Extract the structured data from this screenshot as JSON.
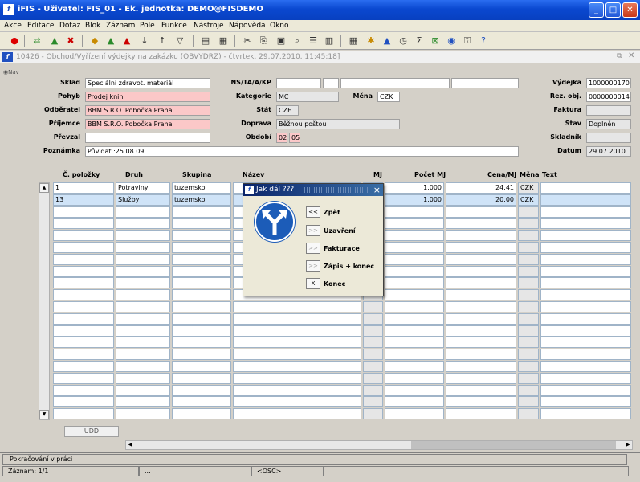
{
  "window": {
    "title": "iFIS - Uživatel: FIS_01 - Ek. jednotka: DEMO@FISDEMO"
  },
  "menu": [
    "Akce",
    "Editace",
    "Dotaz",
    "Blok",
    "Záznam",
    "Pole",
    "Funkce",
    "Nástroje",
    "Nápověda",
    "Okno"
  ],
  "document": {
    "title": "10426 - Obchod/Vyřízení výdejky na zakázku (OBVYDRZ) - čtvrtek, 29.07.2010, 11:45:18]"
  },
  "nav": {
    "label": "Nav"
  },
  "form": {
    "sklad": {
      "label": "Sklad",
      "value": "Speciální zdravot. materiál"
    },
    "pohyb": {
      "label": "Pohyb",
      "value": "Prodej knih"
    },
    "odberatel": {
      "label": "Odběratel",
      "value": "BBM S.R.O. Pobočka Praha"
    },
    "prijemce": {
      "label": "Příjemce",
      "value": "BBM S.R.O. Pobočka Praha"
    },
    "prevzal": {
      "label": "Převzal",
      "value": ""
    },
    "poznamka": {
      "label": "Poznámka",
      "value": "Pův.dat.:25.08.09"
    },
    "nstaakp": {
      "label": "NS/TA/A/KP"
    },
    "kategorie": {
      "label": "Kategorie",
      "value": "MC"
    },
    "mena": {
      "label": "Měna",
      "value": "CZK"
    },
    "stat": {
      "label": "Stát",
      "value": "CZE"
    },
    "doprava": {
      "label": "Doprava",
      "value": "Běžnou poštou"
    },
    "obdobi": {
      "label": "Období",
      "year": "02",
      "month": "05"
    },
    "vydejka": {
      "label": "Výdejka",
      "value": "1000000170"
    },
    "rezobj": {
      "label": "Rez. obj.",
      "value": "0000000014"
    },
    "faktura": {
      "label": "Faktura",
      "value": ""
    },
    "stav": {
      "label": "Stav",
      "value": "Doplněn"
    },
    "skladnik": {
      "label": "Skladník",
      "value": ""
    },
    "datum": {
      "label": "Datum",
      "value": "29.07.2010"
    }
  },
  "grid": {
    "headers": {
      "cislo": "Č. položky",
      "druh": "Druh",
      "skupina": "Skupina",
      "nazev": "Název",
      "mj": "MJ",
      "pocet": "Počet MJ",
      "cena": "Cena/MJ",
      "mena": "Měna",
      "text": "Text"
    },
    "rows": [
      {
        "cislo": "1",
        "druh": "Potraviny",
        "skupina": "tuzemsko",
        "nazev": "",
        "mj": "",
        "pocet": "1.000",
        "cena": "24.41",
        "mena": "CZK",
        "text": ""
      },
      {
        "cislo": "13",
        "druh": "Služby",
        "skupina": "tuzemsko",
        "nazev": "",
        "mj": "",
        "pocet": "1.000",
        "cena": "20.00",
        "mena": "CZK",
        "text": ""
      }
    ]
  },
  "udd_button": "UDD",
  "dialog": {
    "title": "Jak dál ???",
    "close": "×",
    "options": [
      {
        "btn": "<<",
        "label": "Zpět",
        "enabled": true
      },
      {
        "btn": ">>",
        "label": "Uzavření",
        "enabled": true
      },
      {
        "btn": ">>",
        "label": "Fakturace",
        "enabled": true
      },
      {
        "btn": ">>",
        "label": "Zápis + konec",
        "enabled": true
      },
      {
        "btn": "X",
        "label": "Konec",
        "enabled": true
      }
    ]
  },
  "status": {
    "message": "Pokračování v práci",
    "record": "Záznam: 1/1",
    "dots": "...",
    "osc": "<OSC>"
  }
}
